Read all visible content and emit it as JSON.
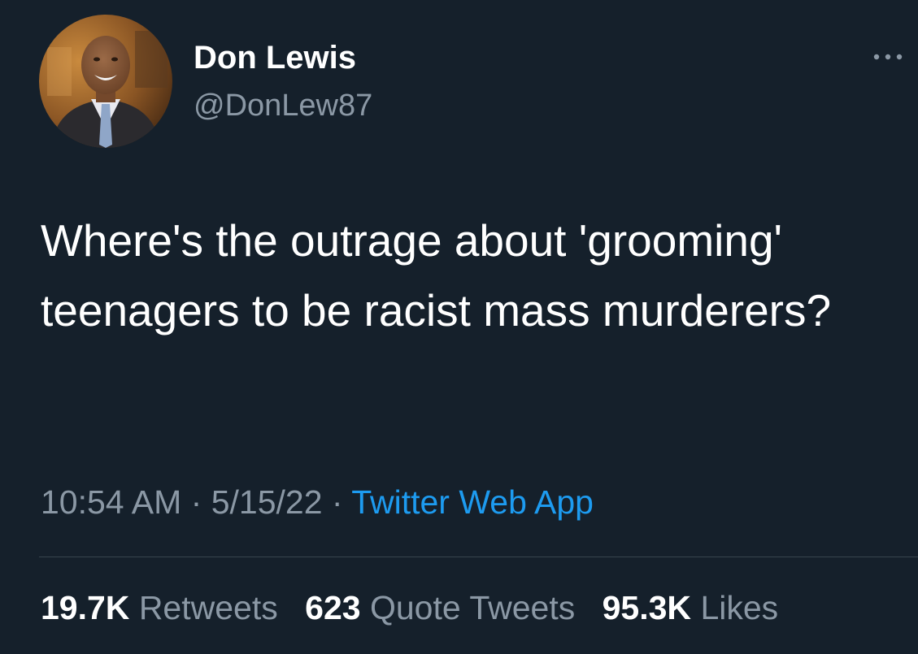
{
  "user": {
    "display_name": "Don Lewis",
    "handle": "@DonLew87",
    "avatar_icon": "profile-photo"
  },
  "tweet": {
    "text": "Where's the outrage about 'grooming' teenagers to be racist mass murderers?",
    "time": "10:54 AM",
    "date": "5/15/22",
    "separator": "·",
    "source": "Twitter Web App"
  },
  "stats": {
    "retweets_count": "19.7K",
    "retweets_label": "Retweets",
    "quotes_count": "623",
    "quotes_label": "Quote Tweets",
    "likes_count": "95.3K",
    "likes_label": "Likes"
  },
  "icons": {
    "more": "more-horizontal-icon"
  },
  "colors": {
    "background": "#15202b",
    "primary_text": "#ffffff",
    "secondary_text": "#8b98a5",
    "link": "#1d9bf0",
    "divider": "#38444d"
  }
}
